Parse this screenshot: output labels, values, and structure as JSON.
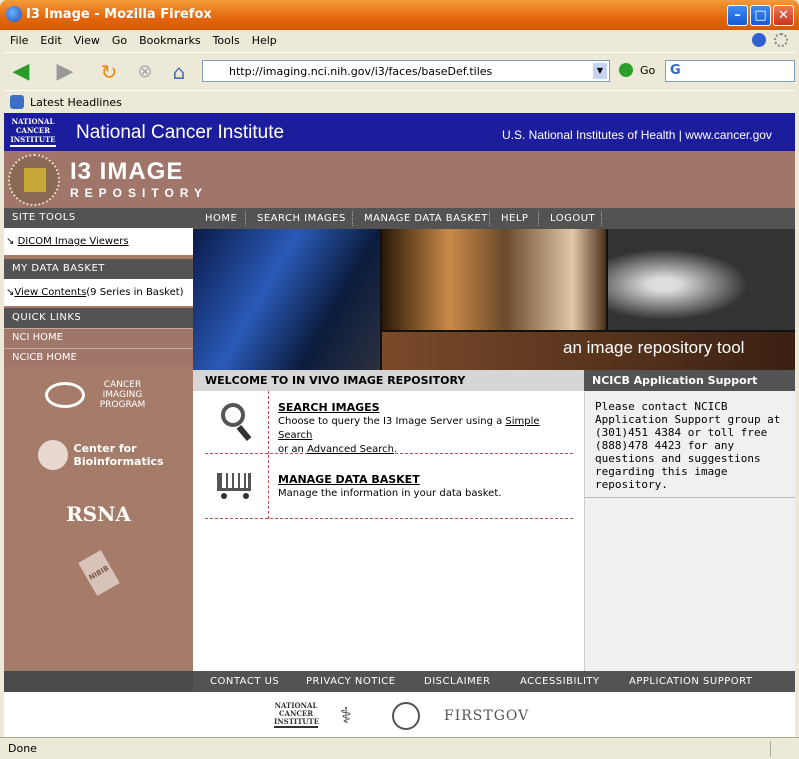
{
  "window": {
    "title": "I3 Image - Mozilla Firefox"
  },
  "menu": [
    "File",
    "Edit",
    "View",
    "Go",
    "Bookmarks",
    "Tools",
    "Help"
  ],
  "toolbar": {
    "url": "http://imaging.nci.nih.gov/i3/faces/baseDef.tiles",
    "go_label": "Go"
  },
  "bookmarks": {
    "item": "Latest Headlines"
  },
  "nci_header": {
    "logo": "NATIONAL CANCER INSTITUTE",
    "name": "National Cancer Institute",
    "links": "U.S. National Institutes of Health  |  www.cancer.gov"
  },
  "brand": {
    "title": "I3 IMAGE",
    "subtitle": "REPOSITORY"
  },
  "sidebar": {
    "site_tools": "SITE TOOLS",
    "dicom_link": "DICOM Image Viewers",
    "data_basket": "MY DATA BASKET",
    "view_contents": "View Contents",
    "basket_count": "(9  Series in Basket)",
    "quick_links": "QUICK LINKS",
    "nci_home": "NCI HOME",
    "ncicb_home": "NCICB HOME",
    "partners": [
      "CANCER IMAGING PROGRAM",
      "Center for Bioinformatics",
      "RSNA",
      "NIBIB"
    ]
  },
  "topnav": [
    "HOME",
    "SEARCH IMAGES",
    "MANAGE DATA BASKET",
    "HELP",
    "LOGOUT"
  ],
  "banner": {
    "tagline": "an image repository tool"
  },
  "welcome": {
    "heading": "WELCOME TO IN VIVO IMAGE REPOSITORY"
  },
  "search_section": {
    "title": "SEARCH IMAGES",
    "desc1": "Choose to query the I3 Image Server using a",
    "simple": "Simple Search",
    "or_an": "or an",
    "advanced": "Advanced Search",
    "period": "."
  },
  "basket_section": {
    "title": "MANAGE DATA BASKET",
    "desc": "Manage the information in your data basket."
  },
  "support": {
    "heading": "NCICB Application Support",
    "text": "Please contact NCICB Application Support group at (301)451 4384 or toll free (888)478 4423 for any questions and suggestions regarding this image repository."
  },
  "footer": {
    "links": [
      "CONTACT US",
      "PRIVACY NOTICE",
      "DISCLAIMER",
      "ACCESSIBILITY",
      "APPLICATION SUPPORT"
    ],
    "logos": [
      "NATIONAL CANCER INSTITUTE",
      "HHS",
      "NIH",
      "FIRSTGOV"
    ]
  },
  "status": {
    "text": "Done"
  },
  "colors": {
    "nci_blue": "#1c1d9c",
    "brand_brown": "#a0766a",
    "nav_gray": "#535353"
  }
}
